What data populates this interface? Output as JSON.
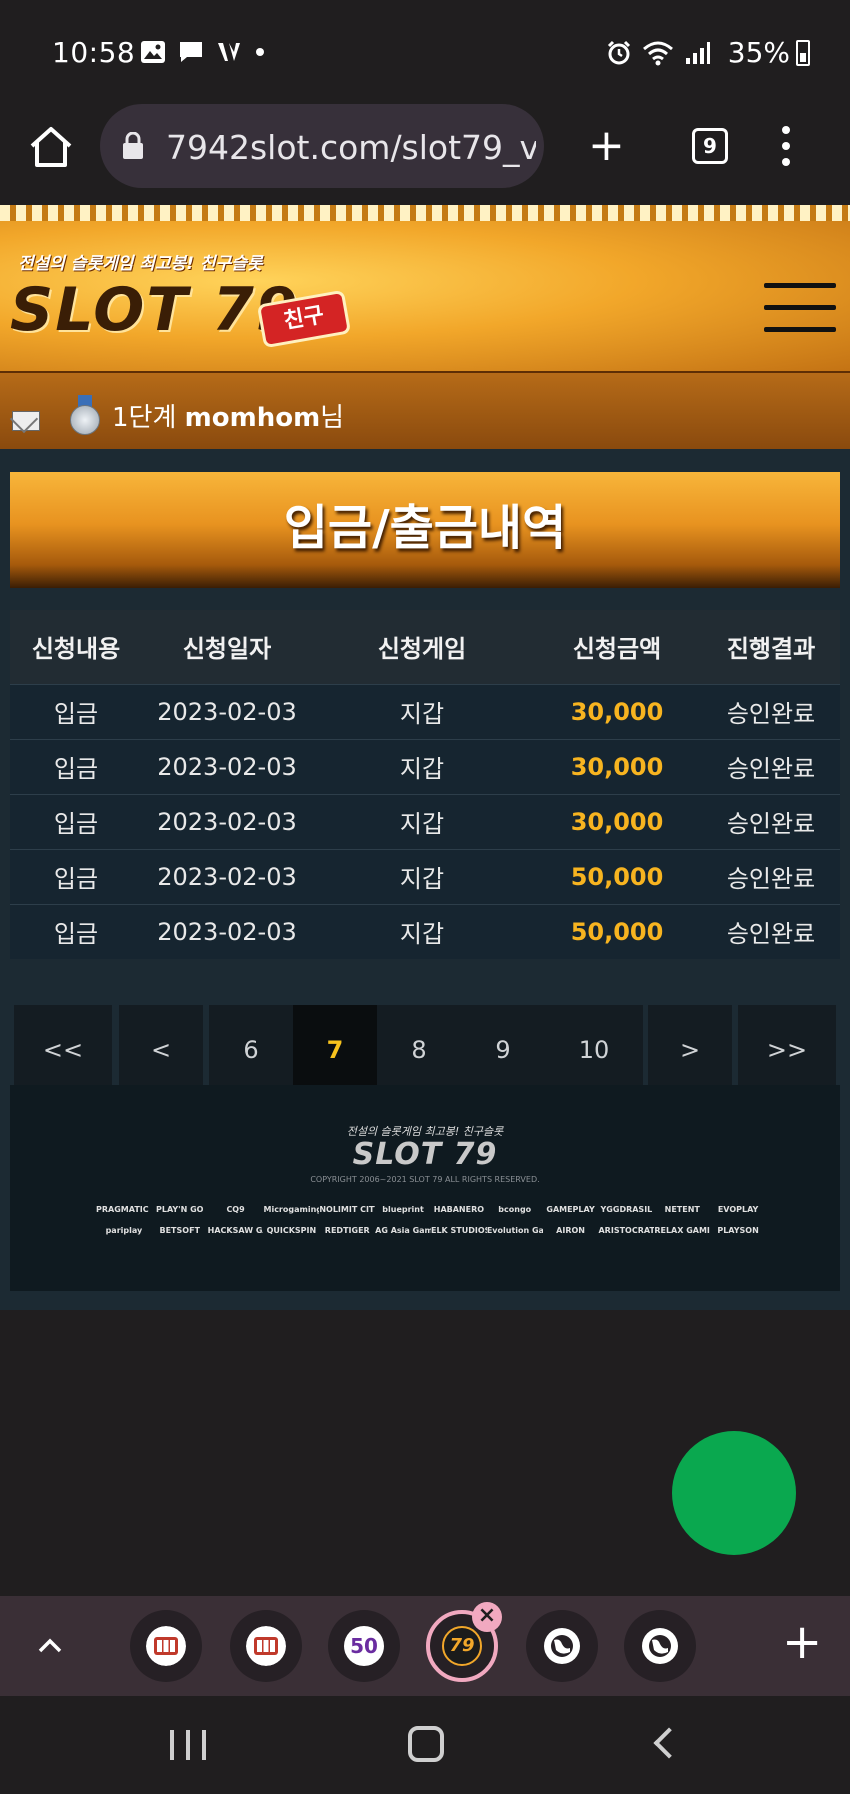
{
  "status_bar": {
    "time": "10:58",
    "battery": "35%",
    "left_icons": [
      "gallery-icon",
      "message-icon",
      "vpn-icon",
      "dot-icon"
    ],
    "right_icons": [
      "alarm-icon",
      "wifi-icon",
      "signal-icon",
      "battery-icon"
    ]
  },
  "browser": {
    "url": "7942slot.com/slot79_v",
    "tab_count": "9"
  },
  "site": {
    "logo_tagline": "전설의 슬롯게임 최고봉! 친구슬롯",
    "logo_text": "SLOT 79",
    "logo_badge": "친구",
    "user_level": "1단계",
    "user_name": "momhom",
    "user_suffix": "님",
    "page_title": "입금/출금내역"
  },
  "table": {
    "headers": [
      "신청내용",
      "신청일자",
      "신청게임",
      "신청금액",
      "진행결과"
    ],
    "rows": [
      [
        "입금",
        "2023-02-03",
        "지갑",
        "30,000",
        "승인완료"
      ],
      [
        "입금",
        "2023-02-03",
        "지갑",
        "30,000",
        "승인완료"
      ],
      [
        "입금",
        "2023-02-03",
        "지갑",
        "30,000",
        "승인완료"
      ],
      [
        "입금",
        "2023-02-03",
        "지갑",
        "50,000",
        "승인완료"
      ],
      [
        "입금",
        "2023-02-03",
        "지갑",
        "50,000",
        "승인완료"
      ]
    ]
  },
  "pagination": {
    "first": "<<",
    "prev": "<",
    "pages": [
      "6",
      "7",
      "8",
      "9",
      "10"
    ],
    "current": "7",
    "next": ">",
    "last": ">>"
  },
  "footer": {
    "tagline": "전설의 슬롯게임 최고봉! 친구슬롯",
    "logo": "SLOT 79",
    "copyright": "COPYRIGHT 2006~2021 SLOT 79 ALL RIGHTS RESERVED.",
    "providers_row1": [
      "PRAGMATIC PLAY",
      "PLAY'N GO",
      "CQ9",
      "Microgaming",
      "NOLIMIT CITY",
      "blueprint",
      "HABANERO",
      "bcongo",
      "GAMEPLAY",
      "YGGDRASIL",
      "NETENT",
      "EVOPLAY"
    ],
    "providers_row2": [
      "pariplay",
      "BETSOFT",
      "HACKSAW GAMES",
      "QUICKSPIN",
      "REDTIGER",
      "AG Asia Gaming",
      "ELK STUDIOS",
      "Evolution Gaming",
      "AIRON",
      "ARISTOCRAT",
      "RELAX GAMING",
      "PLAYSON"
    ]
  },
  "colors": {
    "amount": "#f7b420",
    "active_page": "#f7c21d",
    "fab": "#0aa84f",
    "header_gold": "#f2a72a"
  },
  "tab_strip": {
    "tabs": [
      {
        "icon": "slot-machine-icon",
        "label": ""
      },
      {
        "icon": "slot-machine-icon",
        "label": ""
      },
      {
        "icon": "badge-50-icon",
        "label": "50"
      },
      {
        "icon": "slot79-icon",
        "label": "79",
        "active": true
      },
      {
        "icon": "globe-icon",
        "label": ""
      },
      {
        "icon": "globe-icon",
        "label": ""
      }
    ],
    "close_label": "×",
    "add_label": "+"
  }
}
